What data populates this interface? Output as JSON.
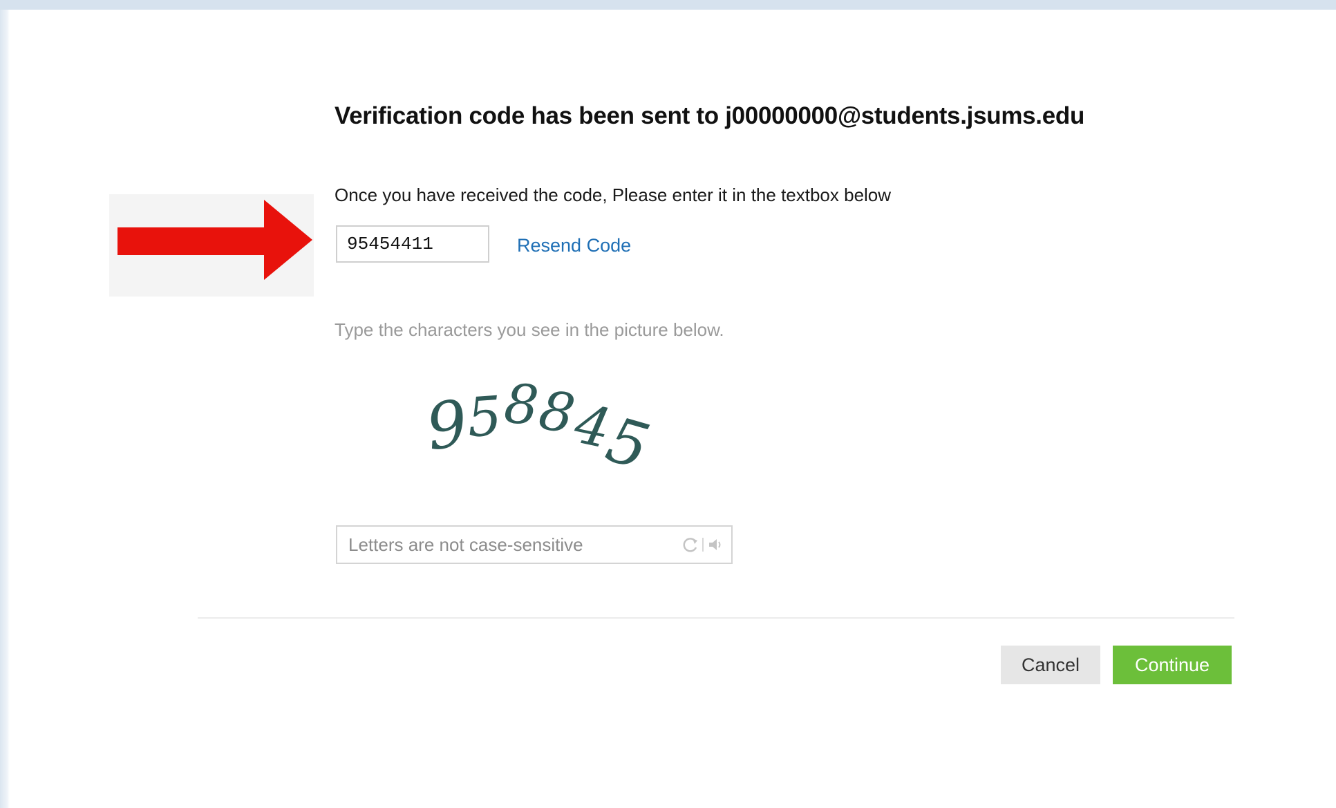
{
  "verification": {
    "heading": "Verification code has been sent to j00000000@students.jsums.edu",
    "instruction": "Once you have received the code, Please enter it in the textbox below",
    "code_value": "95454411",
    "resend_label": "Resend Code"
  },
  "captcha": {
    "prompt": "Type the characters you see in the picture below.",
    "image_text": "958845",
    "placeholder": "Letters are not case-sensitive",
    "value": "",
    "tools": [
      "refresh-icon",
      "audio-icon"
    ]
  },
  "actions": {
    "cancel_label": "Cancel",
    "continue_label": "Continue"
  },
  "annotation": {
    "arrow_color": "#e8120c"
  },
  "colors": {
    "link": "#1f6fb5",
    "continue_button": "#6cbf3a",
    "cancel_button": "#e6e6e6"
  }
}
